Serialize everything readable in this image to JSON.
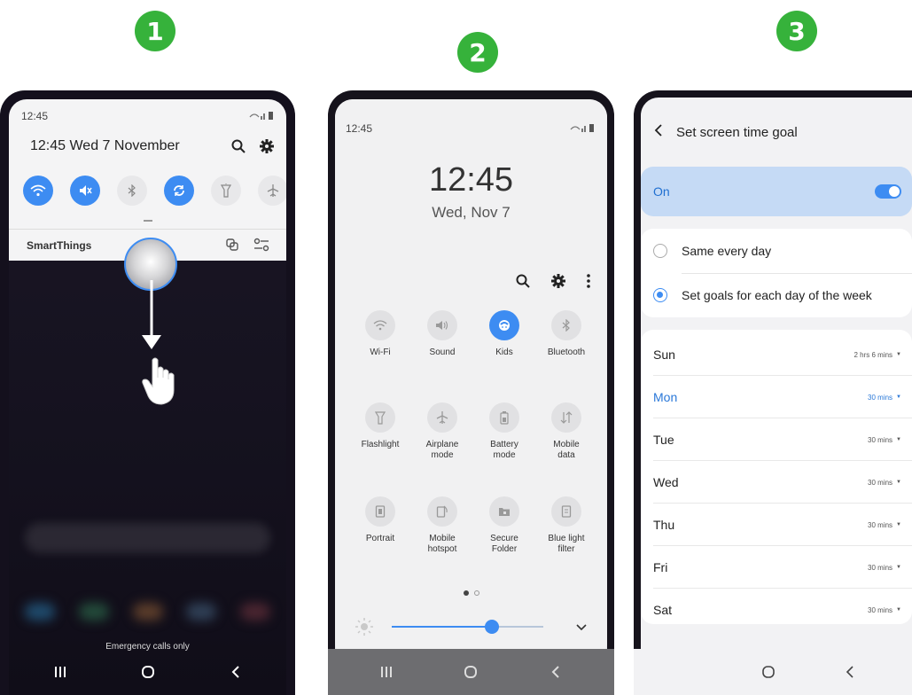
{
  "steps": [
    "1",
    "2",
    "3"
  ],
  "colors": {
    "accent": "#3d8cf2",
    "step_badge": "#36b23b",
    "on_card": "#c5daf5"
  },
  "phone1": {
    "status_time": "12:45",
    "datetime": "12:45  Wed 7 November",
    "header_icons": [
      "search-icon",
      "gear-icon"
    ],
    "quick_settings": [
      {
        "name": "wifi-icon",
        "active": true
      },
      {
        "name": "mute-icon",
        "active": true
      },
      {
        "name": "bluetooth-icon",
        "active": false
      },
      {
        "name": "sync-icon",
        "active": true
      },
      {
        "name": "flashlight-icon",
        "active": false
      },
      {
        "name": "airplane-icon",
        "active": false
      }
    ],
    "smartthings_label": "SmartThings",
    "emergency_text": "Emergency calls only",
    "gesture": "swipe-down"
  },
  "phone2": {
    "status_time": "12:45",
    "clock": "12:45",
    "date": "Wed, Nov 7",
    "tiles": [
      {
        "label": "Wi-Fi",
        "icon": "wifi-icon",
        "active": false
      },
      {
        "label": "Sound",
        "icon": "sound-icon",
        "active": false
      },
      {
        "label": "Kids",
        "icon": "kids-icon",
        "active": true
      },
      {
        "label": "Bluetooth",
        "icon": "bluetooth-icon",
        "active": false
      },
      {
        "label": "Flashlight",
        "icon": "flashlight-icon",
        "active": false
      },
      {
        "label": "Airplane\nmode",
        "icon": "airplane-icon",
        "active": false
      },
      {
        "label": "Battery\nmode",
        "icon": "battery-icon",
        "active": false
      },
      {
        "label": "Mobile\ndata",
        "icon": "mobile-data-icon",
        "active": false
      },
      {
        "label": "Portrait",
        "icon": "portrait-icon",
        "active": false
      },
      {
        "label": "Mobile\nhotspot",
        "icon": "hotspot-icon",
        "active": false
      },
      {
        "label": "Secure\nFolder",
        "icon": "secure-folder-icon",
        "active": false
      },
      {
        "label": "Blue light\nfilter",
        "icon": "blue-light-icon",
        "active": false
      }
    ],
    "brightness": 0.66,
    "page": 1,
    "page_count": 2
  },
  "phone3": {
    "title": "Set screen time goal",
    "master_label": "On",
    "master_on": true,
    "options": [
      {
        "label": "Same every day",
        "selected": false
      },
      {
        "label": "Set goals for each day of the week",
        "selected": true
      }
    ],
    "days": [
      {
        "day": "Sun",
        "goal": "2 hrs 6 mins",
        "active": false
      },
      {
        "day": "Mon",
        "goal": "30 mins",
        "active": true
      },
      {
        "day": "Tue",
        "goal": "30 mins",
        "active": false
      },
      {
        "day": "Wed",
        "goal": "30 mins",
        "active": false
      },
      {
        "day": "Thu",
        "goal": "30 mins",
        "active": false
      },
      {
        "day": "Fri",
        "goal": "30 mins",
        "active": false
      },
      {
        "day": "Sat",
        "goal": "30 mins",
        "active": false
      }
    ]
  }
}
